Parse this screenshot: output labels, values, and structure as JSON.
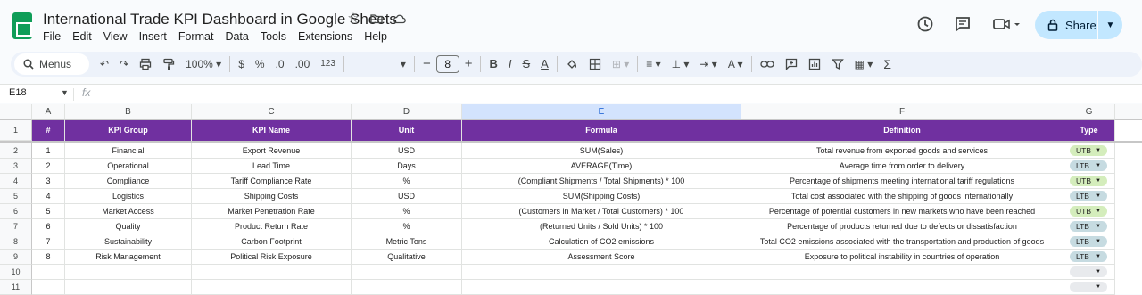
{
  "app": {
    "title": "International Trade KPI Dashboard in Google Sheets",
    "menu": [
      "File",
      "Edit",
      "View",
      "Insert",
      "Format",
      "Data",
      "Tools",
      "Extensions",
      "Help"
    ],
    "share_label": "Share"
  },
  "toolbar": {
    "search_label": "Menus",
    "zoom": "100%",
    "currency": "$",
    "percent": "%",
    "dec_decrease": ".0",
    "dec_increase": ".00",
    "number_format": "123",
    "font_size": "8",
    "minus": "−",
    "plus": "+",
    "bold": "B",
    "italic": "I",
    "strike": "S",
    "text_color": "A"
  },
  "formula_bar": {
    "name_box": "E18",
    "fx": "fx",
    "content": ""
  },
  "sheet": {
    "columns": [
      "A",
      "B",
      "C",
      "D",
      "E",
      "F",
      "G"
    ],
    "selected_column": "E",
    "header_row": [
      "#",
      "KPI Group",
      "KPI Name",
      "Unit",
      "Formula",
      "Definition",
      "Type"
    ],
    "rows": [
      [
        "1",
        "Financial",
        "Export Revenue",
        "USD",
        "SUM(Sales)",
        "Total revenue from exported goods and services",
        "UTB"
      ],
      [
        "2",
        "Operational",
        "Lead Time",
        "Days",
        "AVERAGE(Time)",
        "Average time from order to delivery",
        "LTB"
      ],
      [
        "3",
        "Compliance",
        "Tariff Compliance Rate",
        "%",
        "(Compliant Shipments / Total Shipments) * 100",
        "Percentage of shipments meeting international tariff regulations",
        "UTB"
      ],
      [
        "4",
        "Logistics",
        "Shipping Costs",
        "USD",
        "SUM(Shipping Costs)",
        "Total cost associated with the shipping of goods internationally",
        "LTB"
      ],
      [
        "5",
        "Market Access",
        "Market Penetration Rate",
        "%",
        "(Customers in Market / Total Customers) * 100",
        "Percentage of potential customers in new markets who have been reached",
        "UTB"
      ],
      [
        "6",
        "Quality",
        "Product Return Rate",
        "%",
        "(Returned Units / Sold Units) * 100",
        "Percentage of products returned due to defects or dissatisfaction",
        "LTB"
      ],
      [
        "7",
        "Sustainability",
        "Carbon Footprint",
        "Metric Tons",
        "Calculation of CO2 emissions",
        "Total CO2 emissions associated with the transportation and production of goods",
        "LTB"
      ],
      [
        "8",
        "Risk Management",
        "Political Risk Exposure",
        "Qualitative",
        "Assessment Score",
        "Exposure to political instability in countries of operation",
        "LTB"
      ],
      [
        "",
        "",
        "",
        "",
        "",
        "",
        ""
      ],
      [
        "",
        "",
        "",
        "",
        "",
        "",
        ""
      ]
    ],
    "row_numbers": [
      "1",
      "2",
      "3",
      "4",
      "5",
      "6",
      "7",
      "8",
      "9",
      "10",
      "11"
    ],
    "colors": {
      "header_bg": "#7030a0",
      "utb_chip": "#d4edbc",
      "ltb_chip": "#c6dbe1",
      "empty_chip": "#e8eaed",
      "selected_col": "#d3e3fd"
    }
  }
}
